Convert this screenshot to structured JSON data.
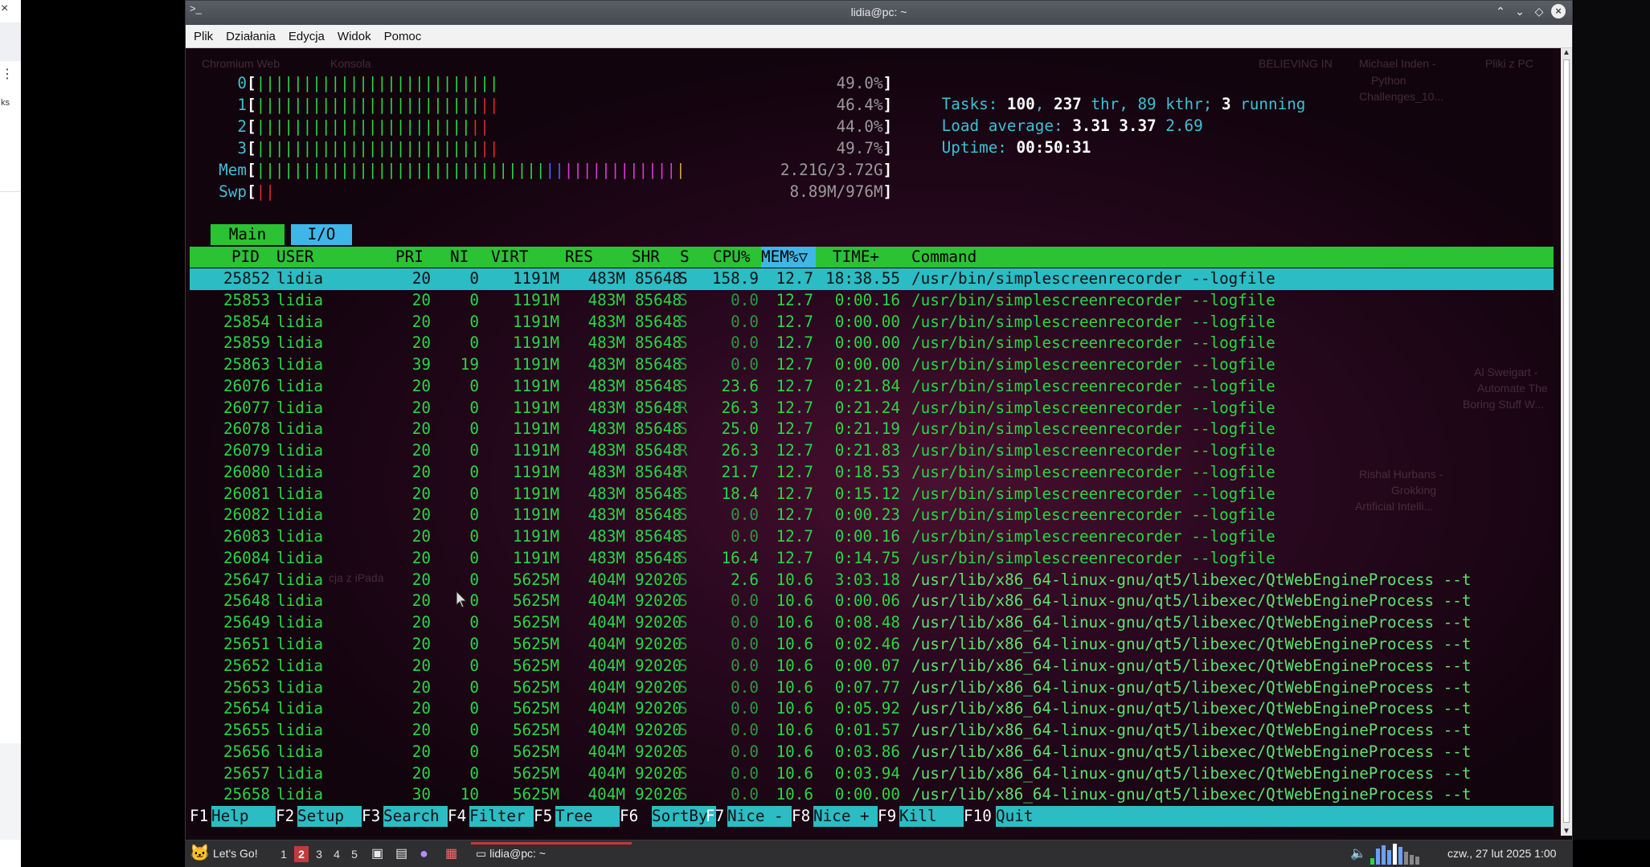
{
  "left_panel": {
    "close_glyph": "×",
    "menu_glyph": "⋮",
    "fragment": "ks"
  },
  "window": {
    "title": "lidia@pc: ~",
    "icon": "terminal-icon",
    "buttons": {
      "keep_above": "⌃",
      "minimize": "⌄",
      "maximize": "◇",
      "close": "×"
    }
  },
  "menubar": [
    "Plik",
    "Działania",
    "Edycja",
    "Widok",
    "Pomoc"
  ],
  "htop": {
    "cpus": [
      {
        "id": "0",
        "percent": "49.0%",
        "green": 26,
        "red": 0
      },
      {
        "id": "1",
        "percent": "46.4%",
        "green": 24,
        "red": 2
      },
      {
        "id": "2",
        "percent": "44.0%",
        "green": 23,
        "red": 2
      },
      {
        "id": "3",
        "percent": "49.7%",
        "green": 24,
        "red": 2
      }
    ],
    "mem": {
      "label": "Mem",
      "value": "2.21G/3.72G",
      "green": 31,
      "blue": 2,
      "mag": 12,
      "orange": 1
    },
    "swp": {
      "label": "Swp",
      "value": "8.89M/976M",
      "red": 2
    },
    "tasks": {
      "label": "Tasks:",
      "count": "100",
      "thr": "237",
      "thr_label": "thr,",
      "kthr": "89",
      "kthr_label": "kthr;",
      "running": "3",
      "running_label": "running"
    },
    "load": {
      "label": "Load average:",
      "v1": "3.31",
      "v2": "3.37",
      "v3": "2.69"
    },
    "uptime": {
      "label": "Uptime:",
      "value": "00:50:31"
    },
    "tabs": [
      "Main",
      "I/O"
    ],
    "columns": [
      "PID",
      "USER",
      "PRI",
      "NI",
      "VIRT",
      "RES",
      "SHR",
      "S",
      "CPU%",
      "MEM%",
      "TIME+",
      "Command"
    ],
    "sort_marker": "▽",
    "processes": [
      [
        "25852",
        "lidia",
        "20",
        "0",
        "1191M",
        "483M",
        "85648",
        "S",
        "158.9",
        "12.7",
        "18:38.55",
        "/usr/bin/simplescreenrecorder --logfile"
      ],
      [
        "25853",
        "lidia",
        "20",
        "0",
        "1191M",
        "483M",
        "85648",
        "S",
        "0.0",
        "12.7",
        "0:00.16",
        "/usr/bin/simplescreenrecorder --logfile"
      ],
      [
        "25854",
        "lidia",
        "20",
        "0",
        "1191M",
        "483M",
        "85648",
        "S",
        "0.0",
        "12.7",
        "0:00.00",
        "/usr/bin/simplescreenrecorder --logfile"
      ],
      [
        "25859",
        "lidia",
        "20",
        "0",
        "1191M",
        "483M",
        "85648",
        "S",
        "0.0",
        "12.7",
        "0:00.00",
        "/usr/bin/simplescreenrecorder --logfile"
      ],
      [
        "25863",
        "lidia",
        "39",
        "19",
        "1191M",
        "483M",
        "85648",
        "S",
        "0.0",
        "12.7",
        "0:00.00",
        "/usr/bin/simplescreenrecorder --logfile"
      ],
      [
        "26076",
        "lidia",
        "20",
        "0",
        "1191M",
        "483M",
        "85648",
        "S",
        "23.6",
        "12.7",
        "0:21.84",
        "/usr/bin/simplescreenrecorder --logfile"
      ],
      [
        "26077",
        "lidia",
        "20",
        "0",
        "1191M",
        "483M",
        "85648",
        "R",
        "26.3",
        "12.7",
        "0:21.24",
        "/usr/bin/simplescreenrecorder --logfile"
      ],
      [
        "26078",
        "lidia",
        "20",
        "0",
        "1191M",
        "483M",
        "85648",
        "S",
        "25.0",
        "12.7",
        "0:21.19",
        "/usr/bin/simplescreenrecorder --logfile"
      ],
      [
        "26079",
        "lidia",
        "20",
        "0",
        "1191M",
        "483M",
        "85648",
        "R",
        "26.3",
        "12.7",
        "0:21.83",
        "/usr/bin/simplescreenrecorder --logfile"
      ],
      [
        "26080",
        "lidia",
        "20",
        "0",
        "1191M",
        "483M",
        "85648",
        "R",
        "21.7",
        "12.7",
        "0:18.53",
        "/usr/bin/simplescreenrecorder --logfile"
      ],
      [
        "26081",
        "lidia",
        "20",
        "0",
        "1191M",
        "483M",
        "85648",
        "S",
        "18.4",
        "12.7",
        "0:15.12",
        "/usr/bin/simplescreenrecorder --logfile"
      ],
      [
        "26082",
        "lidia",
        "20",
        "0",
        "1191M",
        "483M",
        "85648",
        "S",
        "0.0",
        "12.7",
        "0:00.23",
        "/usr/bin/simplescreenrecorder --logfile"
      ],
      [
        "26083",
        "lidia",
        "20",
        "0",
        "1191M",
        "483M",
        "85648",
        "S",
        "0.0",
        "12.7",
        "0:00.16",
        "/usr/bin/simplescreenrecorder --logfile"
      ],
      [
        "26084",
        "lidia",
        "20",
        "0",
        "1191M",
        "483M",
        "85648",
        "S",
        "16.4",
        "12.7",
        "0:14.75",
        "/usr/bin/simplescreenrecorder --logfile"
      ],
      [
        "25647",
        "lidia",
        "20",
        "0",
        "5625M",
        "404M",
        "92020",
        "S",
        "2.6",
        "10.6",
        "3:03.18",
        "/usr/lib/x86_64-linux-gnu/qt5/libexec/QtWebEngineProcess --t"
      ],
      [
        "25648",
        "lidia",
        "20",
        "0",
        "5625M",
        "404M",
        "92020",
        "S",
        "0.0",
        "10.6",
        "0:00.06",
        "/usr/lib/x86_64-linux-gnu/qt5/libexec/QtWebEngineProcess --t"
      ],
      [
        "25649",
        "lidia",
        "20",
        "0",
        "5625M",
        "404M",
        "92020",
        "S",
        "0.0",
        "10.6",
        "0:08.48",
        "/usr/lib/x86_64-linux-gnu/qt5/libexec/QtWebEngineProcess --t"
      ],
      [
        "25651",
        "lidia",
        "20",
        "0",
        "5625M",
        "404M",
        "92020",
        "S",
        "0.0",
        "10.6",
        "0:02.46",
        "/usr/lib/x86_64-linux-gnu/qt5/libexec/QtWebEngineProcess --t"
      ],
      [
        "25652",
        "lidia",
        "20",
        "0",
        "5625M",
        "404M",
        "92020",
        "S",
        "0.0",
        "10.6",
        "0:00.07",
        "/usr/lib/x86_64-linux-gnu/qt5/libexec/QtWebEngineProcess --t"
      ],
      [
        "25653",
        "lidia",
        "20",
        "0",
        "5625M",
        "404M",
        "92020",
        "S",
        "0.0",
        "10.6",
        "0:07.77",
        "/usr/lib/x86_64-linux-gnu/qt5/libexec/QtWebEngineProcess --t"
      ],
      [
        "25654",
        "lidia",
        "20",
        "0",
        "5625M",
        "404M",
        "92020",
        "S",
        "0.0",
        "10.6",
        "0:05.92",
        "/usr/lib/x86_64-linux-gnu/qt5/libexec/QtWebEngineProcess --t"
      ],
      [
        "25655",
        "lidia",
        "20",
        "0",
        "5625M",
        "404M",
        "92020",
        "S",
        "0.0",
        "10.6",
        "0:01.57",
        "/usr/lib/x86_64-linux-gnu/qt5/libexec/QtWebEngineProcess --t"
      ],
      [
        "25656",
        "lidia",
        "20",
        "0",
        "5625M",
        "404M",
        "92020",
        "S",
        "0.0",
        "10.6",
        "0:03.86",
        "/usr/lib/x86_64-linux-gnu/qt5/libexec/QtWebEngineProcess --t"
      ],
      [
        "25657",
        "lidia",
        "20",
        "0",
        "5625M",
        "404M",
        "92020",
        "S",
        "0.0",
        "10.6",
        "0:03.94",
        "/usr/lib/x86_64-linux-gnu/qt5/libexec/QtWebEngineProcess --t"
      ],
      [
        "25658",
        "lidia",
        "30",
        "10",
        "5625M",
        "404M",
        "92020",
        "S",
        "0.0",
        "10.6",
        "0:00.00",
        "/usr/lib/x86_64-linux-gnu/qt5/libexec/QtWebEngineProcess --t"
      ]
    ],
    "function_keys": [
      {
        "key": "F1",
        "label": "Help"
      },
      {
        "key": "F2",
        "label": "Setup"
      },
      {
        "key": "F3",
        "label": "Search"
      },
      {
        "key": "F4",
        "label": "Filter"
      },
      {
        "key": "F5",
        "label": "Tree"
      },
      {
        "key": "F6",
        "label": "SortBy"
      },
      {
        "key": "F7",
        "label": "Nice -"
      },
      {
        "key": "F8",
        "label": "Nice +"
      },
      {
        "key": "F9",
        "label": "Kill"
      },
      {
        "key": "F10",
        "label": "Quit"
      }
    ]
  },
  "desktop_bg_text": [
    "Chromium Web",
    "Konsola",
    "BELIEVING IN",
    "Michael Inden -",
    "Pliki z PC",
    "Python",
    "Challenges_10...",
    "Al Sweigart -",
    "Automate The",
    "Boring Stuff W...",
    "Rishal Hurbans -",
    "Grokking",
    "Artificial Intelli...",
    "cja z iPada"
  ],
  "taskbar": {
    "start_label": "Let's Go!",
    "workspaces": [
      "1",
      "2",
      "3",
      "4",
      "5"
    ],
    "active_workspace": "2",
    "task_label": "lidia@pc: ~",
    "clock": "czw., 27 lut 2025 1:00"
  },
  "colors": {
    "meter_green": "#2ad645",
    "meter_red": "#e02a2a",
    "header_bg": "#2bc234",
    "selected_bg": "#2bbcc4",
    "io_tab": "#3fb6e8"
  }
}
